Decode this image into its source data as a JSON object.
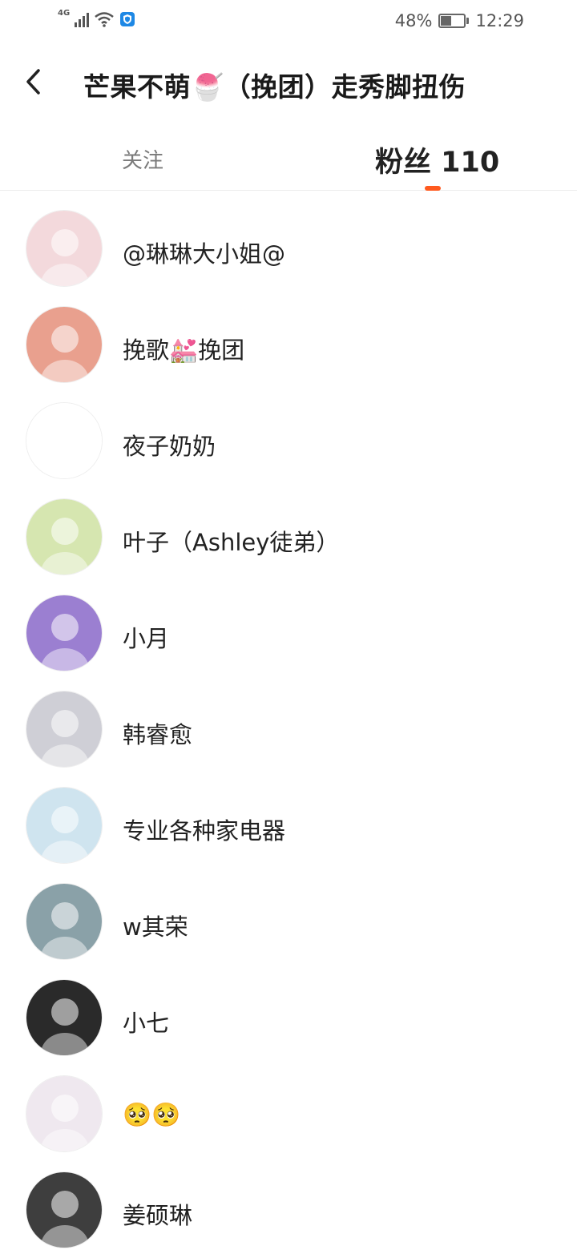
{
  "status_bar": {
    "network": "4G",
    "battery": "48%",
    "battery_level": 0.48,
    "time": "12:29"
  },
  "header": {
    "back_icon": "chevron-left-icon",
    "title": "芒果不萌🍧（挽团）走秀脚扭伤"
  },
  "tabs": {
    "follow_label": "关注",
    "fans_label": "粉丝 110",
    "active": "fans"
  },
  "fans": [
    {
      "name": "@琳琳大小姐@",
      "avatar_color": "#f3d9dc"
    },
    {
      "name": "挽歌💒挽团",
      "avatar_color": "#e9a08e"
    },
    {
      "name": "夜子奶奶",
      "avatar_color": "#ffffff"
    },
    {
      "name": "叶子（Ashley徒弟）",
      "avatar_color": "#d6e6b0"
    },
    {
      "name": "小月",
      "avatar_color": "#9b7fd1"
    },
    {
      "name": "韩睿愈",
      "avatar_color": "#cfcfd6"
    },
    {
      "name": "专业各种家电器",
      "avatar_color": "#cfe4ef"
    },
    {
      "name": "w其荣",
      "avatar_color": "#8aa1a8"
    },
    {
      "name": "小七",
      "avatar_color": "#2a2a2a"
    },
    {
      "name": "🥺🥺",
      "avatar_color": "#efe8ef"
    },
    {
      "name": "姜硕琳",
      "avatar_color": "#3e3e3e"
    }
  ],
  "colors": {
    "accent": "#ff5a1f",
    "text": "#222222",
    "muted": "#7a7a7a"
  }
}
